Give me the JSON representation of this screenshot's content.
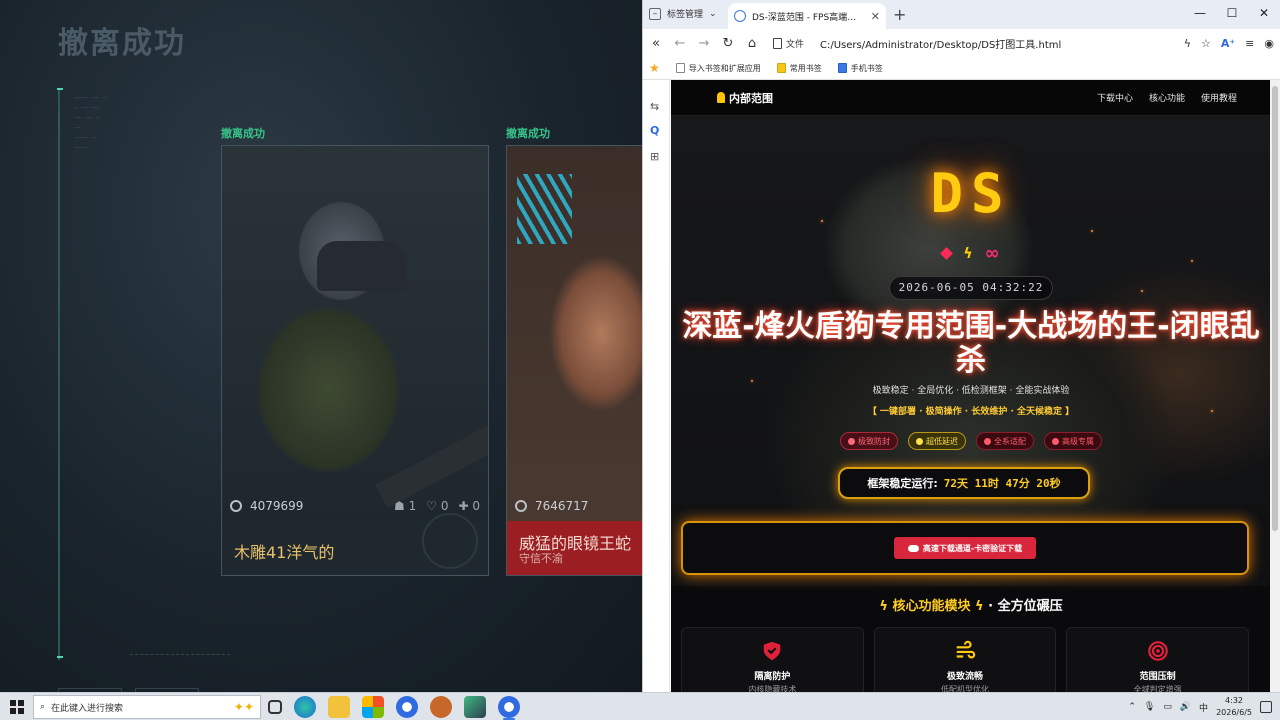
{
  "game": {
    "title": "撤离成功",
    "cards": [
      {
        "label": "撤离成功",
        "score": "4079699",
        "stat1": "1",
        "stat2": "0",
        "stat3": "0",
        "name": "木雕41洋气的",
        "sub": ""
      },
      {
        "label": "撤离成功",
        "score": "7646717",
        "name": "威猛的眼镜王蛇",
        "sub": "守信不渝"
      }
    ]
  },
  "browser": {
    "tab_group": "标签管理",
    "tab_title": "DS-深蓝范围 - FPS高端游戏辅助",
    "address_prefix": "文件",
    "url": "C:/Users/Administrator/Desktop/DS打图工具.html",
    "bookmarks": [
      "导入书签和扩展应用",
      "常用书签",
      "手机书签"
    ]
  },
  "page": {
    "brand": "内部范围",
    "nav_links": [
      "下载中心",
      "核心功能",
      "使用教程"
    ],
    "logo": "DS",
    "datetime": "2026-06-05 04:32:22",
    "headline": "深蓝-烽火盾狗专用范围-大战场的王-闭眼乱杀",
    "subline": "极致稳定 · 全局优化 · 低检测框架 · 全能实战体验",
    "tagline": "【 一键部署 · 极简操作 · 长效维护 · 全天候稳定 】",
    "pills": [
      "极致防封",
      "超低延迟",
      "全系适配",
      "高级专属"
    ],
    "runtime_label": "框架稳定运行:",
    "runtime_value": "72天 11时 47分 20秒",
    "download_label": "高速下载通道-卡密验证下载",
    "section_title_a": "核心功能模块",
    "section_title_b": "· 全方位碾压",
    "features": [
      {
        "title": "隔离防护",
        "desc": "内核隐藏技术"
      },
      {
        "title": "极致流畅",
        "desc": "低配机型优化"
      },
      {
        "title": "范围压制",
        "desc": "全域判定增强"
      }
    ]
  },
  "taskbar": {
    "search_placeholder": "在此键入进行搜索",
    "ime": "中",
    "time": "4:32",
    "date": "2026/6/5"
  },
  "colors": {
    "accent_gold": "#ffcc11",
    "accent_red": "#d8263d",
    "success_green": "#37c48a"
  }
}
